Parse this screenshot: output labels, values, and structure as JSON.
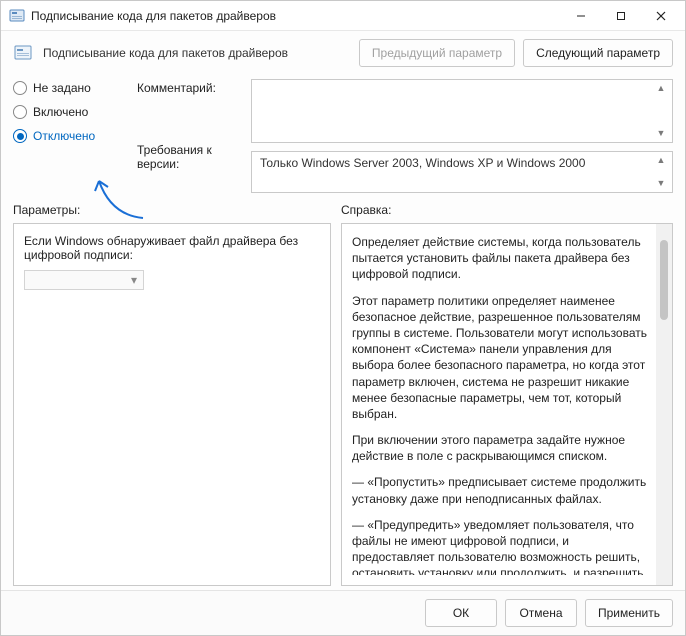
{
  "window": {
    "title": "Подписывание кода для пакетов драйверов"
  },
  "header": {
    "title": "Подписывание кода для пакетов драйверов",
    "prev": "Предыдущий параметр",
    "next": "Следующий параметр"
  },
  "state": {
    "options": {
      "not_configured": "Не задано",
      "enabled": "Включено",
      "disabled": "Отключено"
    },
    "selected": "disabled"
  },
  "labels": {
    "comment": "Комментарий:",
    "supported": "Требования к версии:",
    "options": "Параметры:",
    "help": "Справка:"
  },
  "fields": {
    "comment": "",
    "supported": "Только Windows Server 2003, Windows XP и Windows 2000"
  },
  "options_pane": {
    "prompt": "Если Windows обнаруживает файл драйвера без цифровой подписи:",
    "dropdown_value": ""
  },
  "help": {
    "p1": "Определяет действие системы, когда пользователь пытается установить файлы пакета драйвера без цифровой подписи.",
    "p2": "Этот параметр политики определяет наименее безопасное действие, разрешенное пользователям группы в системе. Пользователи могут использовать компонент «Система» панели управления для выбора более безопасного параметра, но когда этот параметр включен, система не разрешит никакие менее безопасные параметры, чем тот, который выбран.",
    "p3": "При включении этого параметра задайте нужное действие в поле с раскрывающимся списком.",
    "p4": "— «Пропустить» предписывает системе продолжить установку даже при неподписанных файлах.",
    "p5": "— «Предупредить» уведомляет пользователя, что файлы не имеют цифровой подписи, и предоставляет пользователю возможность решить, остановить установку или продолжить, и разрешить ли установку неподписанных файлов. Параметр"
  },
  "footer": {
    "ok": "ОК",
    "cancel": "Отмена",
    "apply": "Применить"
  }
}
